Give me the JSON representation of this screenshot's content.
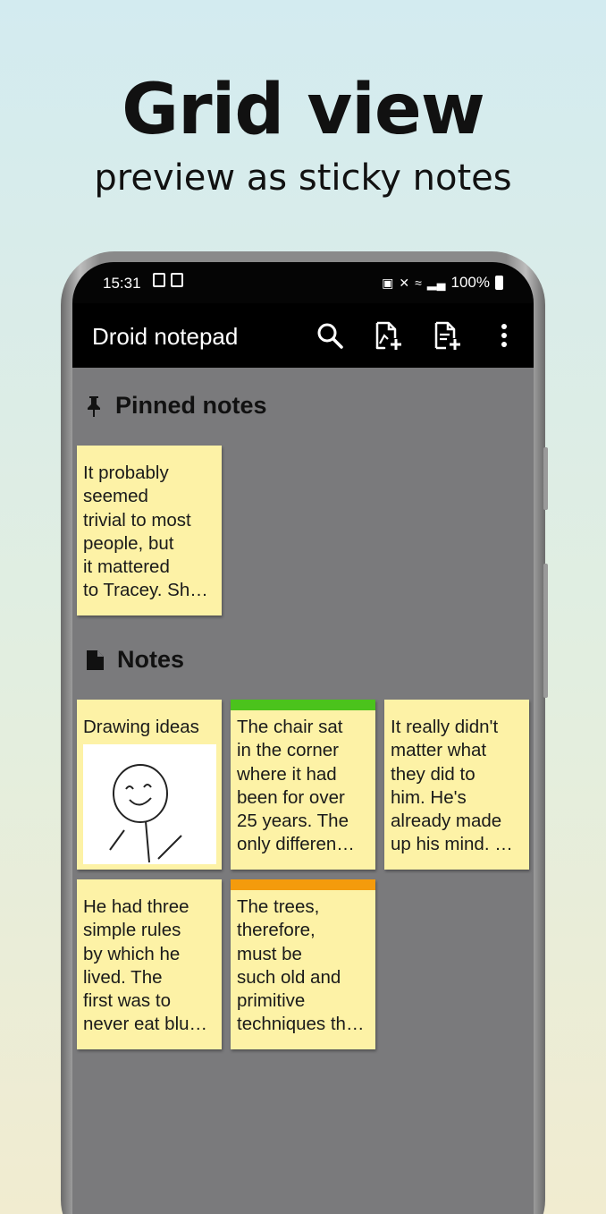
{
  "promo": {
    "headline": "Grid view",
    "subheadline": "preview as sticky notes"
  },
  "status_bar": {
    "time": "15:31",
    "battery": "100%"
  },
  "app_bar": {
    "title": "Droid notepad",
    "actions": [
      "search-icon",
      "new-drawing-icon",
      "new-note-icon",
      "overflow-menu-icon"
    ]
  },
  "sections": {
    "pinned": {
      "title": "Pinned notes",
      "icon": "pin-icon"
    },
    "notes": {
      "title": "Notes",
      "icon": "document-icon"
    }
  },
  "pinned_notes": [
    {
      "text": "It probably\nseemed\ntrivial to most\npeople, but\nit mattered\nto Tracey. Sh…",
      "color_tag": null
    }
  ],
  "notes": [
    {
      "text": "Drawing ideas",
      "has_drawing": true,
      "color_tag": null
    },
    {
      "text": "The chair sat\nin the corner\nwhere it had\nbeen for over\n25 years. The\nonly differen…",
      "color_tag": "#4bc31c"
    },
    {
      "text": "It really didn't\nmatter what\nthey did to\nhim. He's\nalready made\nup his mind. …",
      "color_tag": null
    },
    {
      "text": "He had three\nsimple rules\nby which he\nlived. The\nfirst was to\nnever eat blu…",
      "color_tag": null
    },
    {
      "text": "The trees,\ntherefore,\nmust be\nsuch old and\nprimitive\ntechniques th…",
      "color_tag": "#f49b0c"
    }
  ],
  "colors": {
    "note_background": "#fdf2a6",
    "screen_background": "#7a7a7c",
    "app_bar": "#000000"
  }
}
